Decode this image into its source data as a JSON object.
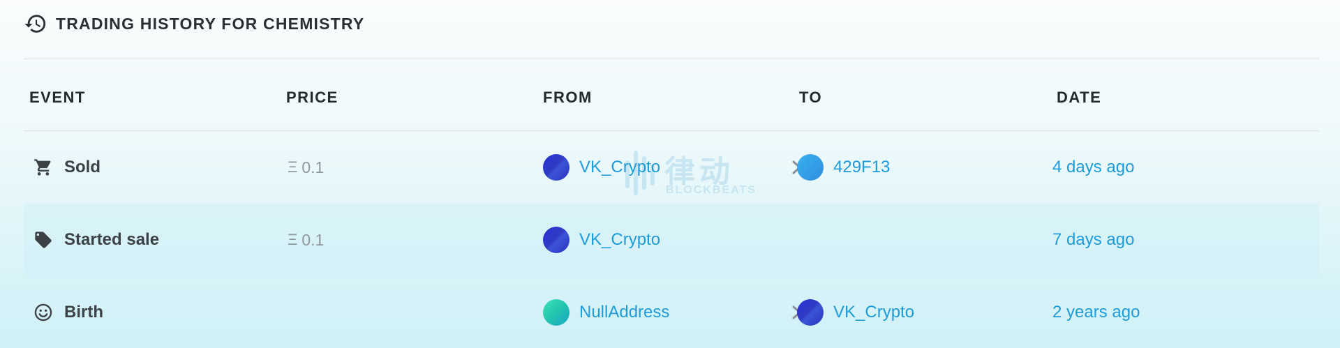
{
  "header": {
    "title": "TRADING HISTORY FOR CHEMISTRY",
    "icon": "history-icon"
  },
  "columns": {
    "event": "EVENT",
    "price": "PRICE",
    "from": "FROM",
    "to": "TO",
    "date": "DATE"
  },
  "rows": [
    {
      "event": "Sold",
      "event_icon": "cart-icon",
      "price_symbol": "Ξ",
      "price": "0.1",
      "from": "VK_Crypto",
      "to": "429F13",
      "date": "4 days ago"
    },
    {
      "event": "Started sale",
      "event_icon": "tag-icon",
      "price_symbol": "Ξ",
      "price": "0.1",
      "from": "VK_Crypto",
      "to": "",
      "date": "7 days ago"
    },
    {
      "event": "Birth",
      "event_icon": "smiley-icon",
      "price_symbol": "",
      "price": "",
      "from": "NullAddress",
      "to": "VK_Crypto",
      "date": "2 years ago"
    }
  ],
  "watermark": {
    "cn": "律动",
    "en": "BLOCKBEATS"
  },
  "colors": {
    "link": "#1f9bd7",
    "heading": "#24292e",
    "price": "#8e979e",
    "divider": "#d8dfe3"
  }
}
